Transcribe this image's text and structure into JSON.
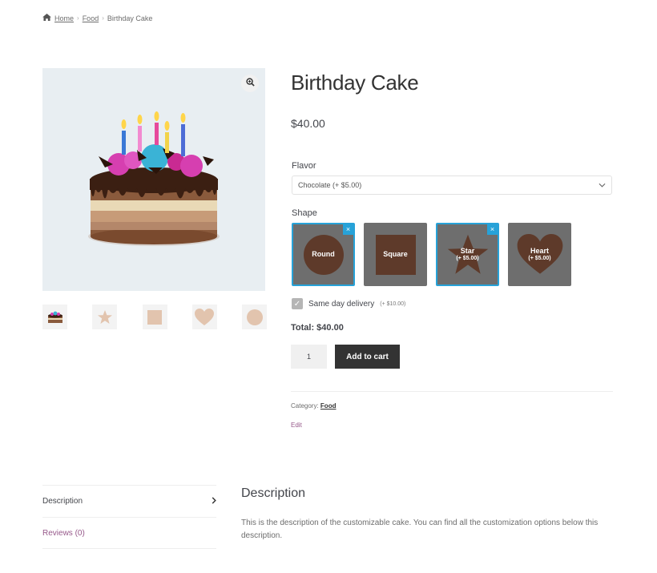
{
  "breadcrumb": {
    "home": "Home",
    "category": "Food",
    "current": "Birthday Cake"
  },
  "product": {
    "title": "Birthday Cake",
    "price": "$40.00",
    "flavor_label": "Flavor",
    "flavor_selected": "Chocolate (+ $5.00)",
    "shape_label": "Shape",
    "shapes": [
      {
        "name": "Round",
        "price": "",
        "selected": true
      },
      {
        "name": "Square",
        "price": "",
        "selected": false
      },
      {
        "name": "Star",
        "price": "(+ $5.00)",
        "selected": true
      },
      {
        "name": "Heart",
        "price": "(+ $5.00)",
        "selected": false
      }
    ],
    "delivery_label": "Same day delivery",
    "delivery_price": "(+ $10.00)",
    "total": "Total: $40.00",
    "quantity": "1",
    "add_to_cart": "Add to cart",
    "category_prefix": "Category:",
    "category_link": "Food",
    "edit": "Edit"
  },
  "tabs": [
    {
      "label": "Description"
    },
    {
      "label": "Reviews (0)"
    }
  ],
  "description": {
    "title": "Description",
    "text": "This is the description of the customizable cake. You can find all the customization options below this description."
  },
  "colors": {
    "accent": "#27a2d8",
    "swatch_bg": "#6e6e6e",
    "shape_brown": "#5e3a2a",
    "link_purple": "#96588a",
    "thumb_beige": "#e2c4ae"
  },
  "icons": [
    "home-icon",
    "zoom-icon",
    "chevron-down-icon",
    "check-icon",
    "close-icon",
    "chevron-right-icon"
  ]
}
